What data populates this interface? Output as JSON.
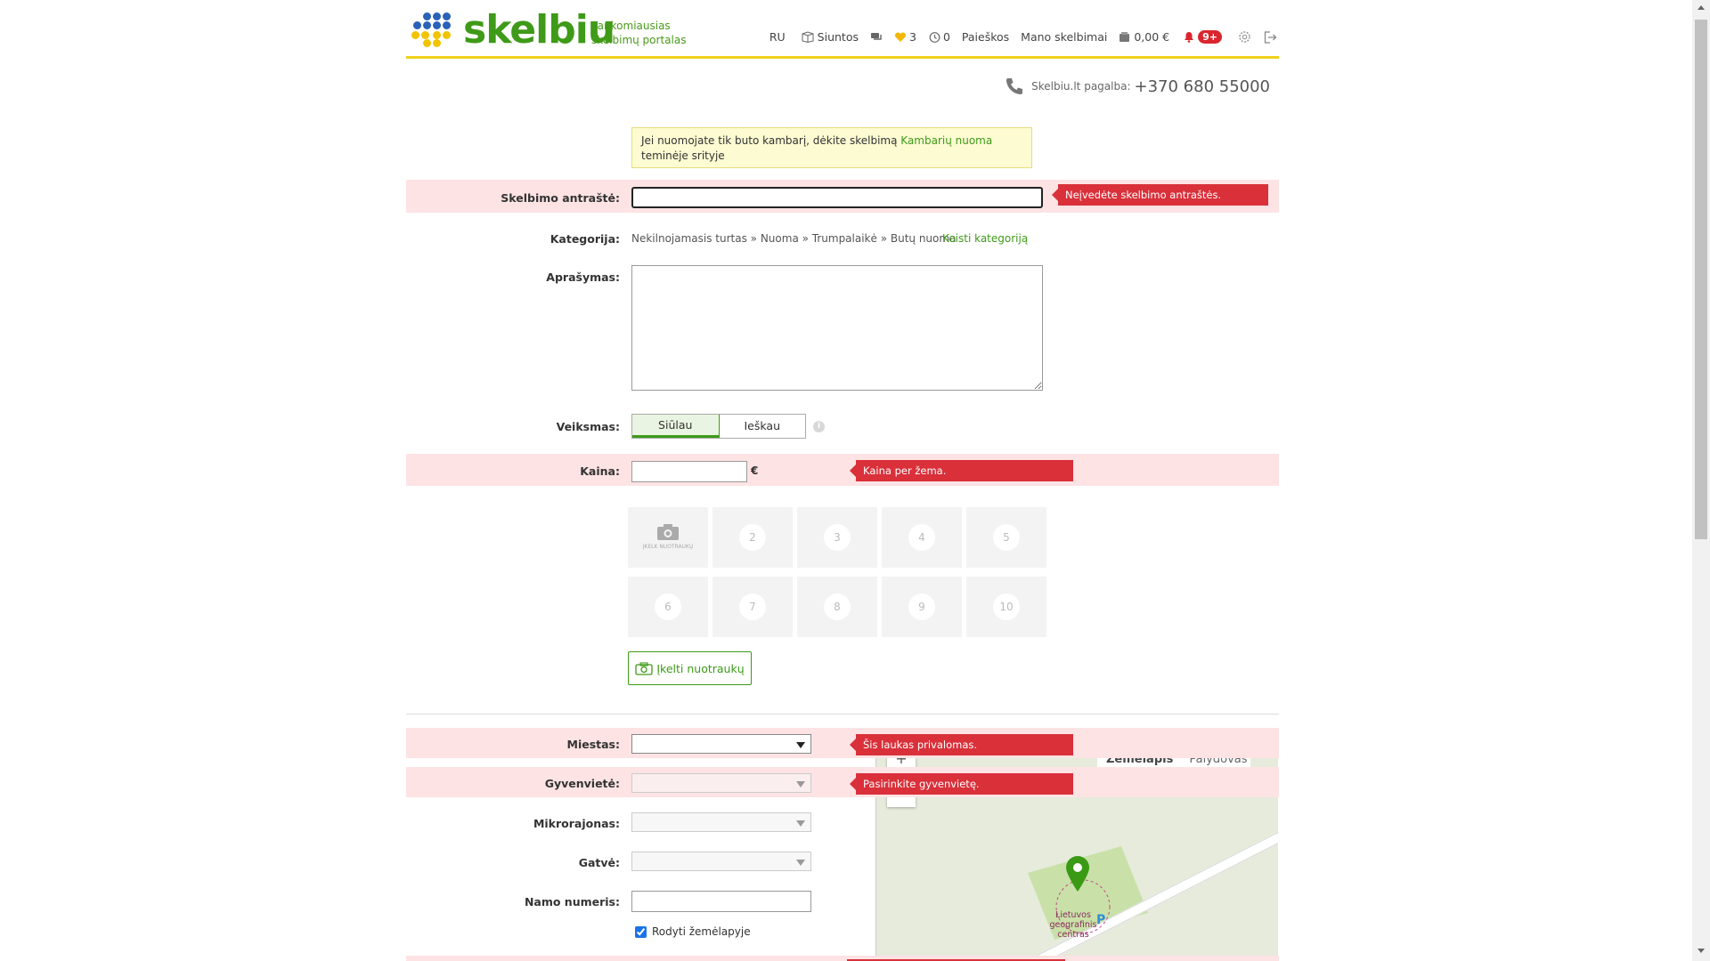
{
  "header": {
    "logo_text": "skelbiu",
    "tagline_1": "Lankomiausias",
    "tagline_2": "skelbimų portalas",
    "nav": {
      "lang": "RU",
      "shipping": "Siuntos",
      "favorites_count": "3",
      "history_count": "0",
      "searches": "Paieškos",
      "my_ads": "Mano skelbimai",
      "balance": "0,00 €",
      "notifications": "9+"
    }
  },
  "help": {
    "label": "Skelbiu.lt pagalba:",
    "phone": "+370 680 55000"
  },
  "notice": {
    "text_1": "Jei nuomojate tik buto kambarį, dėkite skelbimą ",
    "link": "Kambarių nuoma",
    "text_2": " teminėje srityje"
  },
  "form": {
    "title": {
      "label": "Skelbimo antraštė:",
      "value": "",
      "error": "Neįvedėte skelbimo antraštės."
    },
    "category": {
      "label": "Kategorija:",
      "path": "Nekilnojamasis turtas » Nuoma » Trumpalaikė » Butų nuoma",
      "change": "Keisti kategoriją"
    },
    "description": {
      "label": "Aprašymas:",
      "value": ""
    },
    "action": {
      "label": "Veiksmas:",
      "offer": "Siūlau",
      "seek": "Ieškau"
    },
    "price": {
      "label": "Kaina:",
      "value": "",
      "currency": "€",
      "error": "Kaina per žema."
    },
    "photos": {
      "first_caption": "ĮKELK NUOTRAUKŲ",
      "slots": [
        "2",
        "3",
        "4",
        "5",
        "6",
        "7",
        "8",
        "9",
        "10"
      ],
      "upload_button": "Įkelti nuotraukų"
    },
    "city": {
      "label": "Miestas:",
      "value": "",
      "error": "Šis laukas privalomas."
    },
    "settlement": {
      "label": "Gyvenvietė:",
      "value": "",
      "error": "Pasirinkite gyvenvietę."
    },
    "microdistrict": {
      "label": "Mikrorajonas:",
      "value": ""
    },
    "street": {
      "label": "Gatvė:",
      "value": ""
    },
    "house_number": {
      "label": "Namo numeris:",
      "value": ""
    },
    "show_on_map": {
      "label": "Rodyti žemėlapyje",
      "checked": true
    }
  },
  "map": {
    "tab_map": "Žemėlapis",
    "tab_satellite": "Palydovas",
    "zoom_in": "+",
    "place_label": "Lietuvos geografinis centras",
    "parking": "P"
  },
  "colors": {
    "brand_green": "#3e9a18",
    "accent_yellow": "#f0d11a",
    "error_red": "#d9303a",
    "error_bg": "#fde3e4"
  }
}
